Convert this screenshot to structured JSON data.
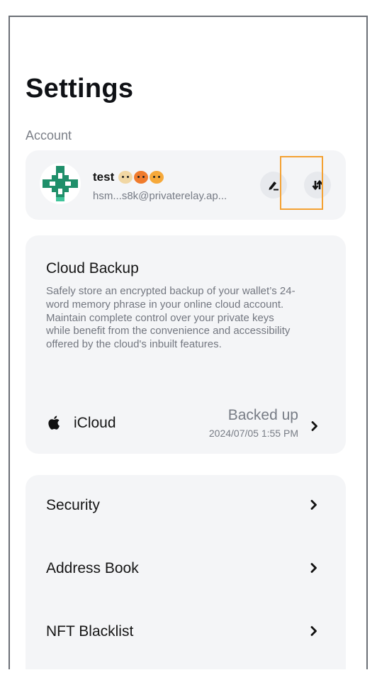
{
  "header": {
    "title": "Settings"
  },
  "account": {
    "section_label": "Account",
    "name": "test",
    "email": "hsm...s8k@privaterelay.ap..."
  },
  "cloud_backup": {
    "title": "Cloud Backup",
    "description": "Safely store an encrypted backup of your wallet’s 24-word memory phrase in your online cloud account. Maintain complete control over your private keys while benefit from the convenience and accessibility offered by the cloud's inbuilt features.",
    "provider_label": "iCloud",
    "status": "Backed up",
    "date": "2024/07/05 1:55 PM"
  },
  "menu": {
    "items": [
      {
        "label": "Security"
      },
      {
        "label": "Address Book"
      },
      {
        "label": "NFT Blacklist"
      }
    ]
  },
  "colors": {
    "card_bg": "#f4f5f7",
    "highlight": "#f4a132",
    "avatar_green": "#1f8f6a"
  }
}
